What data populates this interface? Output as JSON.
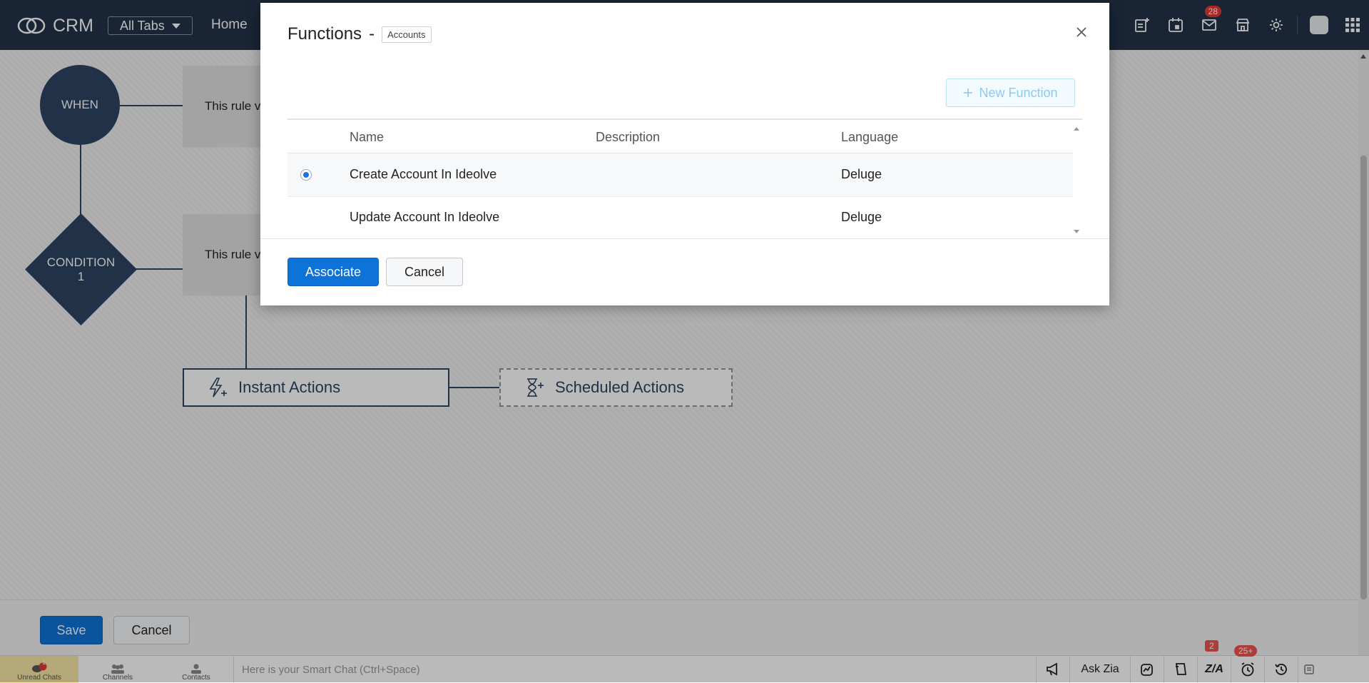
{
  "header": {
    "brand": "CRM",
    "all_tabs": "All Tabs",
    "home": "Home",
    "mail_badge": "28"
  },
  "flow": {
    "when": "WHEN",
    "condition_line1": "CONDITION",
    "condition_line2": "1",
    "rule_text_1": "This rule v",
    "rule_text_2": "This rule v",
    "instant_actions": "Instant Actions",
    "scheduled_actions": "Scheduled Actions"
  },
  "page_actions": {
    "save": "Save",
    "cancel": "Cancel"
  },
  "modal": {
    "title": "Functions",
    "separator": "-",
    "module": "Accounts",
    "new_function": "New Function",
    "columns": {
      "name": "Name",
      "description": "Description",
      "language": "Language"
    },
    "rows": [
      {
        "name": "Create Account In Ideolve",
        "description": "",
        "language": "Deluge",
        "selected": true
      },
      {
        "name": "Update Account In Ideolve",
        "description": "",
        "language": "Deluge",
        "selected": false
      }
    ],
    "associate": "Associate",
    "cancel": "Cancel"
  },
  "chatbar": {
    "tabs": [
      {
        "label": "Unread Chats",
        "badge": "1"
      },
      {
        "label": "Channels"
      },
      {
        "label": "Contacts"
      }
    ],
    "placeholder": "Here is your Smart Chat (Ctrl+Space)",
    "ask_zia": "Ask Zia",
    "zia_badge": "2",
    "reminder_badge": "25+"
  },
  "colors": {
    "topbar": "#233349",
    "node": "#2d4463",
    "primary": "#0e73d9",
    "badge": "#e53935"
  }
}
